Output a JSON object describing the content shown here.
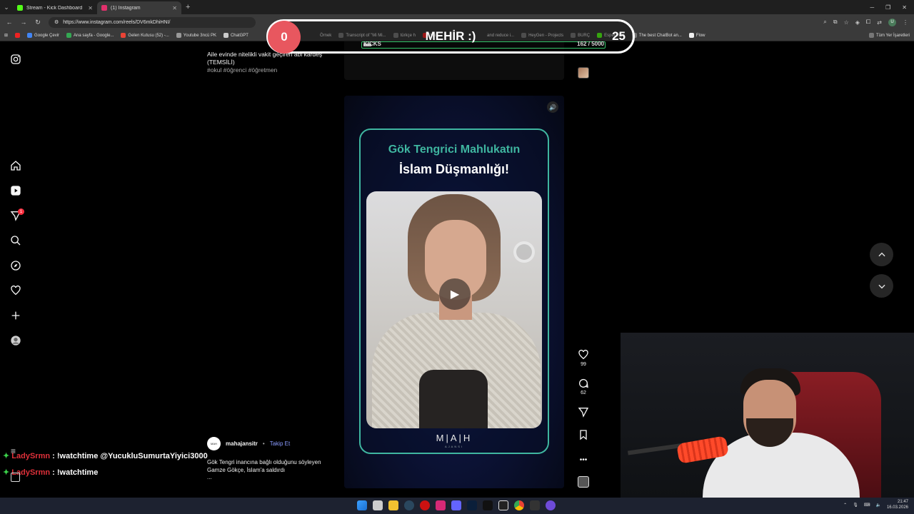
{
  "browser": {
    "tabs": [
      {
        "label": "Stream - Kick Dashboard",
        "color": "#53fc18",
        "active": false
      },
      {
        "label": "(1) Instagram",
        "color": "#e1306c",
        "active": true
      }
    ],
    "new_tab": "+",
    "url": "https://www.instagram.com/reels/DV6mkDhiHNI/",
    "profile_initial": "U",
    "bookmarks": [
      "Google Çevir",
      "Ana sayfa - Google...",
      "Gelen Kutusu (52) -...",
      "Youtube 3ncü PK",
      "ChatGPT",
      "Örnek",
      "Transcript of \"Mi Mi...",
      "türkçe h",
      "You",
      "and reduce i...",
      "HeyGen - Projects",
      "BURÇ",
      "Esperanza",
      "The best ChatBot an...",
      "Flow"
    ],
    "bookmarks_all": "Tüm Yer İşaretleri"
  },
  "sidebar": {
    "icons": [
      "instagram-logo-icon",
      "home-icon",
      "reels-icon",
      "messages-icon",
      "search-icon",
      "explore-icon",
      "notifications-icon",
      "create-icon",
      "profile-icon"
    ],
    "messages_badge": "1"
  },
  "previous_post": {
    "caption": "Aile evinde nitelikli vakit geçiren abi kardeş (TEMSİLİ)",
    "tags": "#okul #öğrenci #öğretmen"
  },
  "reel": {
    "title_line1": "Gök Tengrici Mahlukatın",
    "title_line2": "İslam Düşmanlığı!",
    "logo": "M|A|H",
    "logo_sub": "AJANSI",
    "likes": "99",
    "comments": "62",
    "author": "mahajansitr",
    "follow": "Takip Et",
    "separator": "•",
    "description": "Gök Tengri inancına bağlı olduğunu söyleyen Gamze Gökçe, İslam'a saldırdı",
    "more": "..."
  },
  "kick_overlay": {
    "left_value": "0",
    "title": "MEHİR :)",
    "right_value": "25",
    "label": "KICKS",
    "current": "162",
    "goal": "/ 5000",
    "progress": 0.0324
  },
  "chat": {
    "menu_icon": "≡",
    "lines": [
      {
        "user": "LadySrmn",
        "message": ": !watchtime @YucukluSumurtaYiyici3000"
      },
      {
        "user": "LadySrmn",
        "message": ": !watchtime"
      }
    ]
  },
  "taskbar": {
    "time": "21:47",
    "date": "16.03.2026"
  }
}
